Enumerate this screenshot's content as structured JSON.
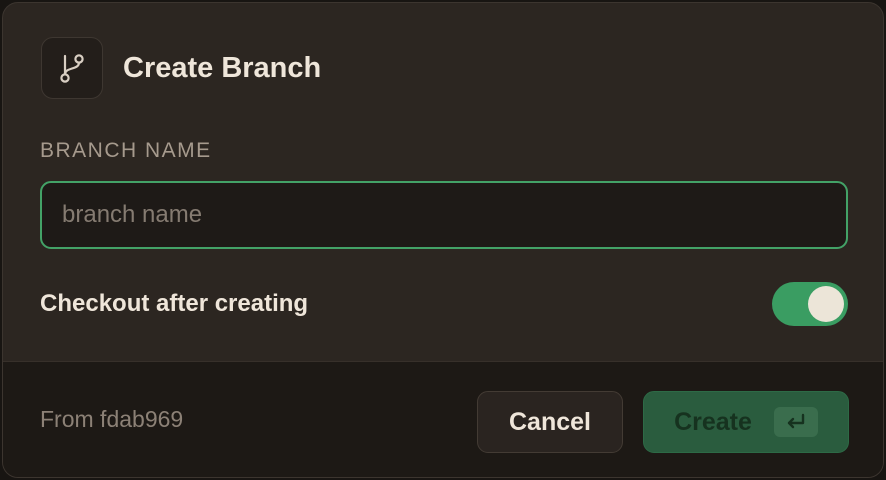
{
  "dialog": {
    "title": "Create Branch",
    "header_icon": "git-branch-icon"
  },
  "branch_field": {
    "label": "BRANCH NAME",
    "value": "",
    "placeholder": "branch name"
  },
  "checkout_toggle": {
    "label": "Checkout after creating",
    "enabled": true
  },
  "footer": {
    "from_text": "From fdab969",
    "cancel_label": "Cancel",
    "create_label": "Create",
    "create_shortcut_icon": "enter-key-icon"
  },
  "colors": {
    "accent": "#43a267",
    "toggle_on": "#3a9d62",
    "create_button": "#2a5c3e"
  }
}
